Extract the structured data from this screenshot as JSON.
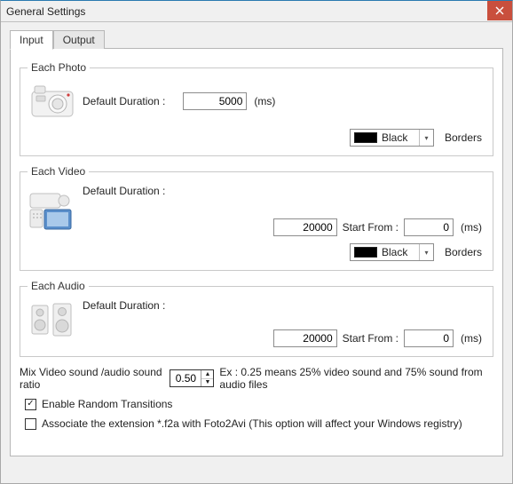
{
  "window": {
    "title": "General Settings"
  },
  "tabs": {
    "input": "Input",
    "output": "Output"
  },
  "groups": {
    "photo": {
      "legend": "Each Photo",
      "duration_label": "Default Duration :",
      "duration_value": "5000",
      "unit": "(ms)",
      "color_name": "Black",
      "color_hex": "#000000",
      "borders_label": "Borders"
    },
    "video": {
      "legend": "Each Video",
      "duration_label": "Default Duration :",
      "duration_value": "20000",
      "startfrom_label": "Start From :",
      "startfrom_value": "0",
      "unit": "(ms)",
      "color_name": "Black",
      "color_hex": "#000000",
      "borders_label": "Borders"
    },
    "audio": {
      "legend": "Each Audio",
      "duration_label": "Default Duration :",
      "duration_value": "20000",
      "startfrom_label": "Start From :",
      "startfrom_value": "0",
      "unit": "(ms)"
    }
  },
  "mix": {
    "label": "Mix Video sound /audio sound ratio",
    "value": "0.50",
    "hint": "Ex : 0.25 means 25% video sound and 75% sound from audio files"
  },
  "checks": {
    "random_transitions": {
      "label": "Enable Random Transitions",
      "checked": true
    },
    "associate_ext": {
      "label": "Associate the extension *.f2a with Foto2Avi (This option will affect your Windows registry)",
      "checked": false
    }
  }
}
